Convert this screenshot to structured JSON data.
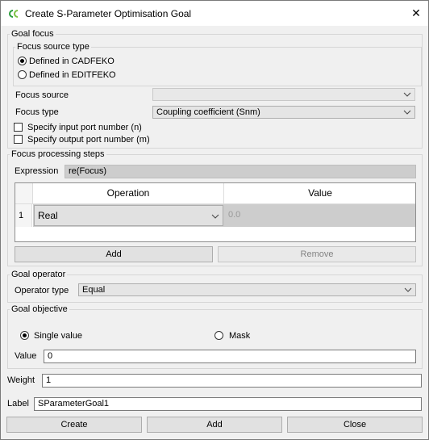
{
  "window": {
    "title": "Create S-Parameter Optimisation Goal",
    "close_glyph": "✕"
  },
  "goal_focus": {
    "title": "Goal focus",
    "source_type": {
      "title": "Focus source type",
      "options": [
        {
          "label": "Defined in CADFEKO",
          "selected": true
        },
        {
          "label": "Defined in EDITFEKO",
          "selected": false
        }
      ]
    },
    "focus_source_label": "Focus source",
    "focus_source_value": "",
    "focus_type_label": "Focus type",
    "focus_type_value": "Coupling coefficient (Snm)",
    "input_port_label": "Specify input port number (n)",
    "output_port_label": "Specify output port number (m)"
  },
  "processing": {
    "title": "Focus processing steps",
    "expression_label": "Expression",
    "expression_value": "re(Focus)",
    "table": {
      "columns": [
        "Operation",
        "Value"
      ],
      "rows": [
        {
          "index": "1",
          "operation": "Real",
          "value": "0.0"
        }
      ]
    },
    "add_label": "Add",
    "remove_label": "Remove"
  },
  "goal_operator": {
    "title": "Goal operator",
    "type_label": "Operator type",
    "type_value": "Equal"
  },
  "goal_objective": {
    "title": "Goal objective",
    "options": [
      {
        "label": "Single value",
        "selected": true
      },
      {
        "label": "Mask",
        "selected": false
      }
    ],
    "value_label": "Value",
    "value": "0"
  },
  "weight": {
    "label": "Weight",
    "value": "1"
  },
  "label_field": {
    "label": "Label",
    "value": "SParameterGoal1"
  },
  "buttons": {
    "create": "Create",
    "add": "Add",
    "close": "Close"
  },
  "colors": {
    "accent": "#2a9d3c",
    "selected_row": "#cdcdcd"
  },
  "icons": {
    "app": "cadfeko-logo-icon",
    "dropdown": "chevron-down-icon"
  }
}
